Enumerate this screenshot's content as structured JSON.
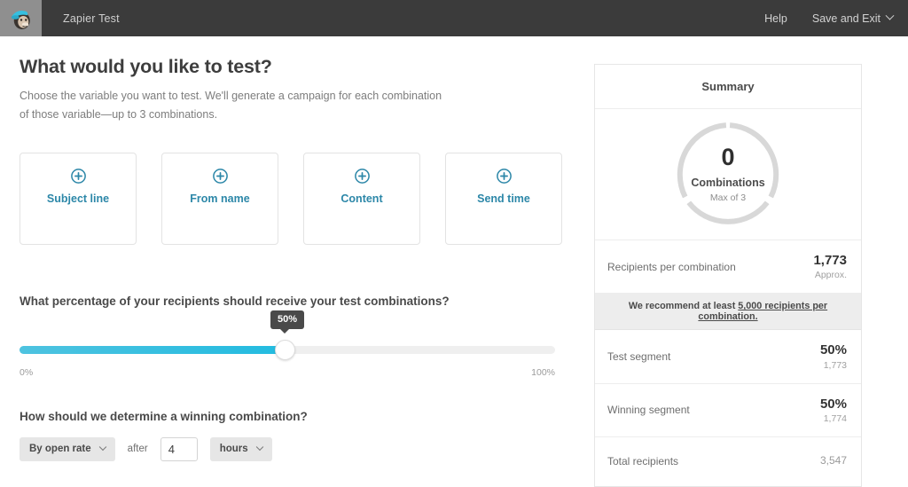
{
  "topbar": {
    "logo_icon": "mailchimp-freddie-logo",
    "app_title": "Zapier Test",
    "help_label": "Help",
    "save_exit_label": "Save and Exit",
    "chevron_icon": "chevron-down-icon"
  },
  "main": {
    "title": "What would you like to test?",
    "subtitle": "Choose the variable you want to test. We'll generate a campaign for each combination of those variable—up to 3 combinations.",
    "cards": [
      {
        "label": "Subject line",
        "icon": "plus-circle-icon"
      },
      {
        "label": "From name",
        "icon": "plus-circle-icon"
      },
      {
        "label": "Content",
        "icon": "plus-circle-icon"
      },
      {
        "label": "Send time",
        "icon": "plus-circle-icon"
      }
    ],
    "slider": {
      "question": "What percentage of your recipients should receive your test combinations?",
      "value_label": "50%",
      "value": 50,
      "min_label": "0%",
      "max_label": "100%"
    },
    "winner": {
      "question": "How should we determine a winning combination?",
      "metric_value": "By open rate",
      "after_label": "after",
      "duration_value": "4",
      "unit_value": "hours"
    }
  },
  "summary": {
    "heading": "Summary",
    "donut": {
      "count": "0",
      "caption": "Combinations",
      "max_label": "Max of 3",
      "segments": 3,
      "filled": 0,
      "track_color": "#d8d8d8"
    },
    "rows": [
      {
        "label": "Recipients per combination",
        "main": "1,773",
        "sub": "Approx."
      },
      {
        "label": "Test segment",
        "main": "50%",
        "sub": "1,773"
      },
      {
        "label": "Winning segment",
        "main": "50%",
        "sub": "1,774"
      },
      {
        "label": "Total recipients",
        "main": "3,547",
        "sub": ""
      }
    ],
    "recommend_prefix": "We recommend at least ",
    "recommend_link": "5,000 recipients per combination."
  },
  "colors": {
    "accent": "#2c87a8",
    "slider": "#22bbe0",
    "topbar": "#3b3b3b"
  }
}
